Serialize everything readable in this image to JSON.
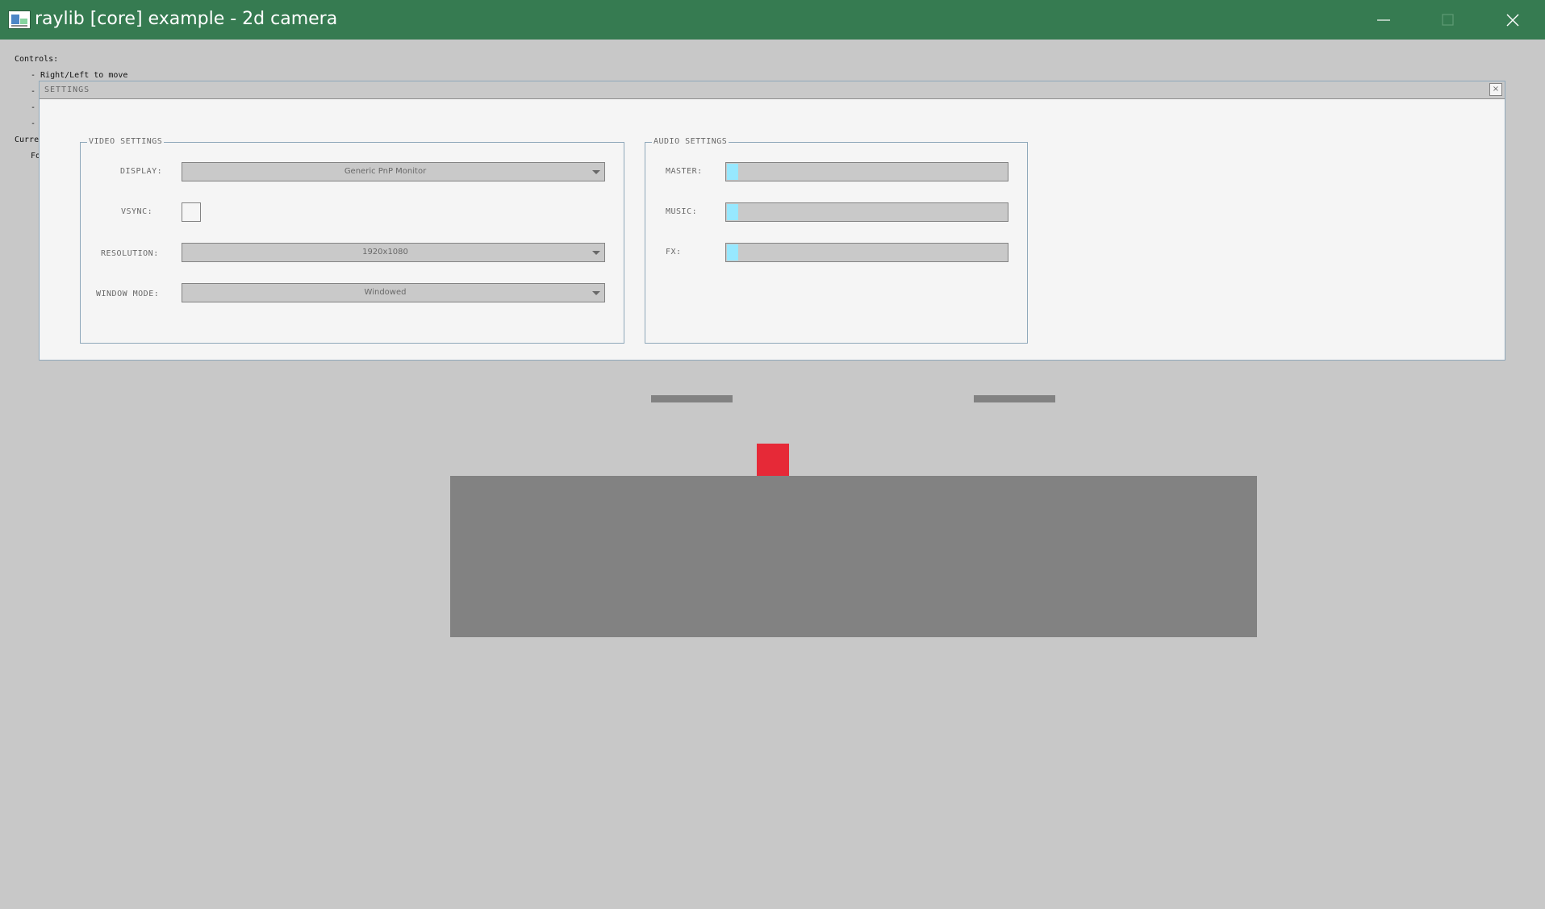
{
  "window": {
    "title": "raylib [core] example - 2d camera"
  },
  "icons": {
    "app": "raylib-app-icon",
    "minimize": "minimize-icon",
    "maximize": "maximize-icon",
    "close": "close-icon"
  },
  "background_text": {
    "controls_heading": "Controls:",
    "line1": "- Right/Left to move",
    "line2_fragment": "- S",
    "line3_fragment": "- C",
    "line4_fragment": "- R",
    "current_fragment": "Curre",
    "sub_fragment": "Fo"
  },
  "settings": {
    "title": "SETTINGS",
    "close_label": "×",
    "video": {
      "label": "VIDEO SETTINGS",
      "display_label": "DISPLAY:",
      "display_value": "Generic PnP Monitor",
      "vsync_label": "VSYNC:",
      "vsync_checked": false,
      "resolution_label": "RESOLUTION:",
      "resolution_value": "1920x1080",
      "window_mode_label": "WINDOW MODE:",
      "window_mode_value": "Windowed"
    },
    "audio": {
      "label": "AUDIO SETTINGS",
      "master_label": "MASTER:",
      "master_level": 0.04,
      "music_label": "MUSIC:",
      "music_level": 0.04,
      "fx_label": "FX:",
      "fx_level": 0.04
    }
  },
  "colors": {
    "titlebar": "#367b51",
    "background": "#c8c8c8",
    "player": "#e62937",
    "platform": "#828282",
    "slider_fill": "#97e8ff"
  }
}
